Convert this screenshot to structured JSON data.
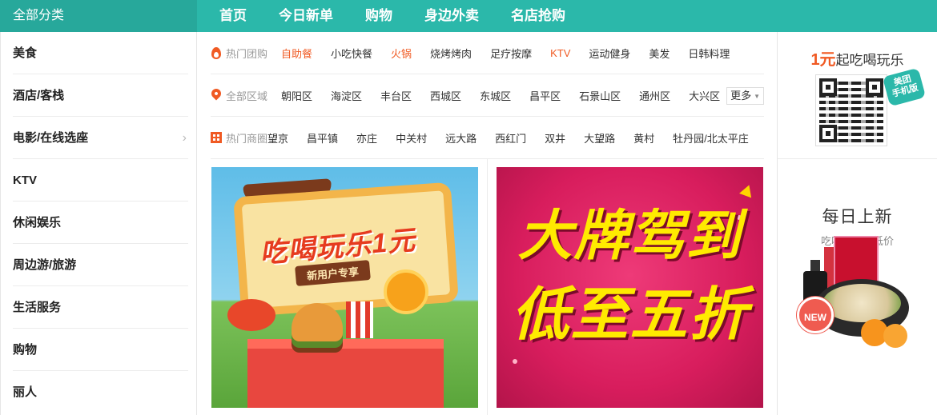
{
  "header": {
    "category_label": "全部分类",
    "nav": [
      "首页",
      "今日新单",
      "购物",
      "身边外卖",
      "名店抢购"
    ]
  },
  "sidebar": {
    "items": [
      {
        "label": "美食",
        "has_arrow": false
      },
      {
        "label": "酒店/客栈",
        "has_arrow": false
      },
      {
        "label": "电影/在线选座",
        "has_arrow": true
      },
      {
        "label": "KTV",
        "has_arrow": false
      },
      {
        "label": "休闲娱乐",
        "has_arrow": false
      },
      {
        "label": "周边游/旅游",
        "has_arrow": false
      },
      {
        "label": "生活服务",
        "has_arrow": false
      },
      {
        "label": "购物",
        "has_arrow": false
      },
      {
        "label": "丽人",
        "has_arrow": false
      }
    ]
  },
  "filters": {
    "hot_deals": {
      "label": "热门团购",
      "icon": "flame-icon",
      "items": [
        {
          "text": "自助餐",
          "hot": true
        },
        {
          "text": "小吃快餐",
          "hot": false
        },
        {
          "text": "火锅",
          "hot": true
        },
        {
          "text": "烧烤烤肉",
          "hot": false
        },
        {
          "text": "足疗按摩",
          "hot": false
        },
        {
          "text": "KTV",
          "hot": true
        },
        {
          "text": "运动健身",
          "hot": false
        },
        {
          "text": "美发",
          "hot": false
        },
        {
          "text": "日韩料理",
          "hot": false
        }
      ]
    },
    "districts": {
      "label": "全部区域",
      "icon": "location-pin-icon",
      "items": [
        "朝阳区",
        "海淀区",
        "丰台区",
        "西城区",
        "东城区",
        "昌平区",
        "石景山区",
        "通州区",
        "大兴区"
      ],
      "more_label": "更多"
    },
    "business_areas": {
      "label": "热门商圈",
      "icon": "building-icon",
      "items": [
        "望京",
        "昌平镇",
        "亦庄",
        "中关村",
        "远大路",
        "西红门",
        "双井",
        "大望路",
        "黄村",
        "牡丹园/北太平庄"
      ]
    }
  },
  "banners": {
    "left": {
      "title": "吃喝玩乐1元",
      "ribbon": "新用户专享"
    },
    "right": {
      "line1": "大牌驾到",
      "line2": "低至五折"
    }
  },
  "right_panel": {
    "promo": {
      "price": "1元",
      "text": "起吃喝玩乐",
      "qr_tag": "美团\n手机版"
    },
    "daily": {
      "title": "每日上新",
      "subtitle": "吃喝玩乐最低价",
      "badge": "NEW"
    }
  },
  "colors": {
    "brand": "#2bb8aa",
    "hot": "#f05a23"
  }
}
